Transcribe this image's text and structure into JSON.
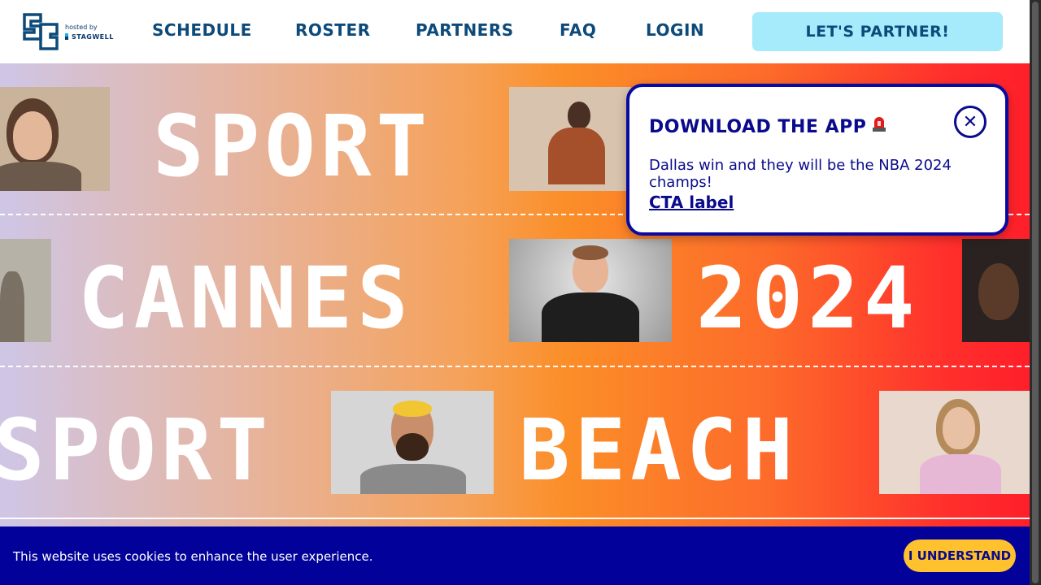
{
  "header": {
    "logo_hosted_by": "hosted by",
    "logo_sponsor": "STAGWELL",
    "nav": [
      "SCHEDULE",
      "ROSTER",
      "PARTNERS",
      "FAQ",
      "LOGIN"
    ],
    "cta_label": "LET'S PARTNER!"
  },
  "hero": {
    "row1": [
      "SPORT"
    ],
    "row2": [
      "CANNES",
      "2024"
    ],
    "row3": [
      "SPORT",
      "BEACH"
    ]
  },
  "popup": {
    "title": "DOWNLOAD THE APP",
    "title_icon": "siren-icon",
    "message": "Dallas win and they will be the NBA 2024 champs!",
    "cta": "CTA label",
    "close_icon": "close-icon"
  },
  "cookie_bar": {
    "message": "This website uses cookies to enhance the user experience.",
    "button": "I UNDERSTAND"
  },
  "colors": {
    "brand_navy": "#0d4a7a",
    "popup_blue": "#0a0aa0",
    "cta_cyan": "#a5ebfb",
    "cookie_bg": "#02029a",
    "cookie_button": "#ffc22e"
  }
}
